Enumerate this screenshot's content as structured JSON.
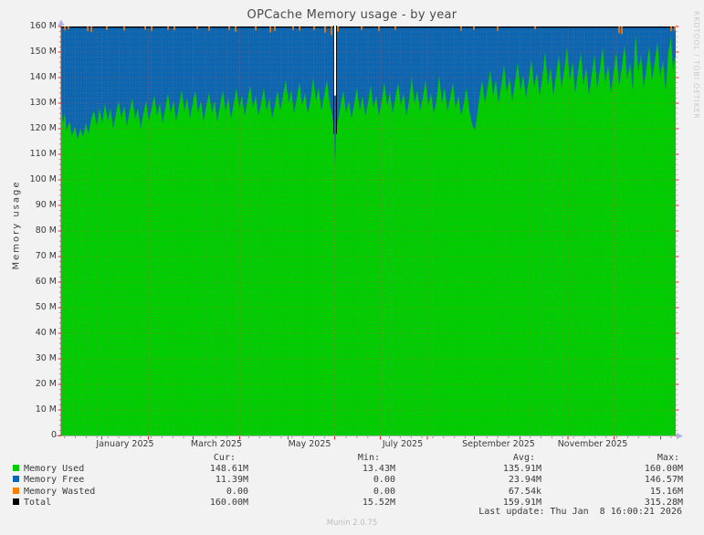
{
  "title": "OPCache Memory usage - by year",
  "watermark": "RRDTOOL / TOBI OETIKER",
  "footer": {
    "munin_version": "Munin 2.0.75",
    "last_update": "Last update: Thu Jan  8 16:00:21 2026"
  },
  "y_axis": {
    "label": "Memory usage",
    "ticks": [
      [
        0,
        "0"
      ],
      [
        10,
        "10 M"
      ],
      [
        20,
        "20 M"
      ],
      [
        30,
        "30 M"
      ],
      [
        40,
        "40 M"
      ],
      [
        50,
        "50 M"
      ],
      [
        60,
        "60 M"
      ],
      [
        70,
        "70 M"
      ],
      [
        80,
        "80 M"
      ],
      [
        90,
        "90 M"
      ],
      [
        100,
        "100 M"
      ],
      [
        110,
        "110 M"
      ],
      [
        120,
        "120 M"
      ],
      [
        130,
        "130 M"
      ],
      [
        140,
        "140 M"
      ],
      [
        150,
        "150 M"
      ],
      [
        160,
        "160 M"
      ]
    ]
  },
  "x_axis": {
    "months": [
      {
        "label": "January 2025",
        "cx": 137
      },
      {
        "label": "March 2025",
        "cx": 237
      },
      {
        "label": "May 2025",
        "cx": 339
      },
      {
        "label": "July 2025",
        "cx": 441
      },
      {
        "label": "September 2025",
        "cx": 546
      },
      {
        "label": "November 2025",
        "cx": 649
      }
    ]
  },
  "legend": {
    "headers": [
      {
        "label": "Cur:",
        "right": 258
      },
      {
        "label": "Min:",
        "right": 416
      },
      {
        "label": "Avg:",
        "right": 586
      },
      {
        "label": "Max:",
        "right": 744
      }
    ],
    "value_col_rights": [
      272,
      433,
      593,
      748
    ],
    "rows": [
      {
        "name": "Memory Used",
        "color": "#00cc00",
        "values": [
          "148.61M",
          "13.43M",
          "135.91M",
          "160.00M"
        ]
      },
      {
        "name": "Memory Free",
        "color": "#0e65b0",
        "values": [
          "11.39M",
          "0.00",
          "23.94M",
          "146.57M"
        ]
      },
      {
        "name": "Memory Wasted",
        "color": "#ff7d00",
        "values": [
          "0.00",
          "0.00",
          "67.54k",
          "15.16M"
        ]
      },
      {
        "name": "Total",
        "color": "#000000",
        "values": [
          "160.00M",
          "15.52M",
          "159.91M",
          "315.28M"
        ]
      }
    ]
  },
  "chart_data": {
    "type": "area",
    "title": "OPCache Memory usage - by year",
    "ylabel": "Memory usage",
    "ylim": [
      0,
      160
    ],
    "x_span": "Dec 2024 - Jan 8 2026",
    "x_unit": "pixel offset across plot (0-673) spanning the year",
    "grid": "dotted, minor 2M / weekly, major 10M / monthly",
    "legend_position": "bottom",
    "series": [
      {
        "name": "Memory Used",
        "render": "area",
        "color": "#00cc00"
      },
      {
        "name": "Memory Free",
        "render": "area stacked up to total 160M",
        "color": "#0e65b0"
      },
      {
        "name": "Memory Wasted",
        "render": "small spikes hanging from the 160M total line",
        "color": "#ff7d00"
      },
      {
        "name": "Total",
        "render": "line at 160M",
        "color": "#000000",
        "value": 160
      }
    ],
    "colors": {
      "used": "#00cc00",
      "free": "#0e65b0",
      "wasted": "#ff7d00",
      "total": "#000000",
      "grid_minor": "#888888",
      "grid_major": "#cc5555",
      "tick_red": "#ee0000",
      "axis": "#999999",
      "arrow": "#aab4e6"
    },
    "total_line": 160,
    "gap": {
      "x": 300,
      "comment": "data gap around Jun 1 2025: white slit 160M->133M, total edge down to 118M, blue notch to ~105M; momentary min total 15.52M / min used 13.43M",
      "min_used": 13.43,
      "min_total": 15.52
    },
    "used_points": [
      [
        0,
        130
      ],
      [
        2,
        122
      ],
      [
        4,
        126
      ],
      [
        6,
        119
      ],
      [
        9,
        123
      ],
      [
        12,
        117
      ],
      [
        15,
        121
      ],
      [
        18,
        116
      ],
      [
        21,
        120
      ],
      [
        24,
        117
      ],
      [
        27,
        122
      ],
      [
        30,
        118
      ],
      [
        33,
        124
      ],
      [
        36,
        127
      ],
      [
        39,
        121
      ],
      [
        42,
        128
      ],
      [
        45,
        122
      ],
      [
        48,
        130
      ],
      [
        51,
        123
      ],
      [
        54,
        128
      ],
      [
        57,
        120
      ],
      [
        60,
        126
      ],
      [
        63,
        131
      ],
      [
        66,
        124
      ],
      [
        69,
        129
      ],
      [
        72,
        121
      ],
      [
        75,
        127
      ],
      [
        78,
        132
      ],
      [
        81,
        124
      ],
      [
        84,
        128
      ],
      [
        87,
        120
      ],
      [
        90,
        126
      ],
      [
        93,
        131
      ],
      [
        96,
        123
      ],
      [
        99,
        128
      ],
      [
        102,
        133
      ],
      [
        105,
        125
      ],
      [
        108,
        130
      ],
      [
        111,
        122
      ],
      [
        114,
        128
      ],
      [
        117,
        134
      ],
      [
        120,
        126
      ],
      [
        123,
        131
      ],
      [
        126,
        123
      ],
      [
        129,
        129
      ],
      [
        132,
        135
      ],
      [
        135,
        127
      ],
      [
        138,
        132
      ],
      [
        141,
        124
      ],
      [
        144,
        130
      ],
      [
        147,
        135
      ],
      [
        150,
        126
      ],
      [
        153,
        131
      ],
      [
        156,
        123
      ],
      [
        159,
        129
      ],
      [
        162,
        134
      ],
      [
        165,
        126
      ],
      [
        168,
        131
      ],
      [
        171,
        123
      ],
      [
        174,
        129
      ],
      [
        177,
        135
      ],
      [
        180,
        127
      ],
      [
        183,
        132
      ],
      [
        186,
        124
      ],
      [
        189,
        130
      ],
      [
        192,
        136
      ],
      [
        195,
        128
      ],
      [
        198,
        133
      ],
      [
        201,
        125
      ],
      [
        204,
        131
      ],
      [
        207,
        137
      ],
      [
        210,
        128
      ],
      [
        213,
        133
      ],
      [
        216,
        125
      ],
      [
        219,
        130
      ],
      [
        222,
        136
      ],
      [
        225,
        127
      ],
      [
        228,
        132
      ],
      [
        231,
        124
      ],
      [
        234,
        129
      ],
      [
        237,
        135
      ],
      [
        240,
        127
      ],
      [
        243,
        133
      ],
      [
        246,
        139
      ],
      [
        249,
        130
      ],
      [
        252,
        135
      ],
      [
        255,
        126
      ],
      [
        258,
        132
      ],
      [
        261,
        138
      ],
      [
        264,
        129
      ],
      [
        267,
        134
      ],
      [
        270,
        126
      ],
      [
        273,
        131
      ],
      [
        276,
        140
      ],
      [
        279,
        131
      ],
      [
        282,
        136
      ],
      [
        285,
        127
      ],
      [
        288,
        133
      ],
      [
        291,
        139
      ],
      [
        294,
        130
      ],
      [
        297,
        125
      ],
      [
        299,
        119
      ],
      [
        300,
        105
      ],
      [
        301,
        119
      ],
      [
        303,
        123
      ],
      [
        306,
        129
      ],
      [
        309,
        135
      ],
      [
        312,
        126
      ],
      [
        315,
        131
      ],
      [
        318,
        124
      ],
      [
        321,
        130
      ],
      [
        324,
        136
      ],
      [
        327,
        127
      ],
      [
        330,
        133
      ],
      [
        333,
        125
      ],
      [
        336,
        130
      ],
      [
        339,
        137
      ],
      [
        342,
        128
      ],
      [
        345,
        133
      ],
      [
        348,
        125
      ],
      [
        351,
        131
      ],
      [
        354,
        138
      ],
      [
        357,
        129
      ],
      [
        360,
        134
      ],
      [
        363,
        126
      ],
      [
        366,
        132
      ],
      [
        369,
        138
      ],
      [
        372,
        129
      ],
      [
        375,
        134
      ],
      [
        378,
        125
      ],
      [
        381,
        131
      ],
      [
        384,
        140
      ],
      [
        387,
        130
      ],
      [
        390,
        135
      ],
      [
        393,
        127
      ],
      [
        396,
        132
      ],
      [
        399,
        139
      ],
      [
        402,
        129
      ],
      [
        405,
        134
      ],
      [
        408,
        126
      ],
      [
        411,
        131
      ],
      [
        414,
        141
      ],
      [
        417,
        130
      ],
      [
        420,
        136
      ],
      [
        423,
        127
      ],
      [
        426,
        132
      ],
      [
        429,
        138
      ],
      [
        432,
        128
      ],
      [
        435,
        133
      ],
      [
        438,
        125
      ],
      [
        441,
        130
      ],
      [
        444,
        136
      ],
      [
        447,
        127
      ],
      [
        450,
        122
      ],
      [
        453,
        119
      ],
      [
        455,
        124
      ],
      [
        458,
        132
      ],
      [
        461,
        139
      ],
      [
        464,
        130
      ],
      [
        467,
        136
      ],
      [
        470,
        143
      ],
      [
        473,
        133
      ],
      [
        476,
        139
      ],
      [
        479,
        130
      ],
      [
        482,
        137
      ],
      [
        485,
        145
      ],
      [
        488,
        134
      ],
      [
        491,
        140
      ],
      [
        494,
        131
      ],
      [
        497,
        138
      ],
      [
        500,
        146
      ],
      [
        503,
        135
      ],
      [
        506,
        141
      ],
      [
        509,
        132
      ],
      [
        512,
        139
      ],
      [
        515,
        147
      ],
      [
        518,
        136
      ],
      [
        521,
        142
      ],
      [
        524,
        133
      ],
      [
        527,
        140
      ],
      [
        530,
        150
      ],
      [
        533,
        137
      ],
      [
        536,
        144
      ],
      [
        539,
        133
      ],
      [
        542,
        141
      ],
      [
        545,
        149
      ],
      [
        548,
        136
      ],
      [
        551,
        143
      ],
      [
        554,
        152
      ],
      [
        557,
        139
      ],
      [
        560,
        146
      ],
      [
        563,
        134
      ],
      [
        566,
        142
      ],
      [
        569,
        150
      ],
      [
        572,
        137
      ],
      [
        575,
        144
      ],
      [
        578,
        133
      ],
      [
        581,
        141
      ],
      [
        584,
        149
      ],
      [
        587,
        136
      ],
      [
        590,
        143
      ],
      [
        593,
        152
      ],
      [
        596,
        138
      ],
      [
        599,
        145
      ],
      [
        602,
        134
      ],
      [
        605,
        142
      ],
      [
        608,
        150
      ],
      [
        611,
        137
      ],
      [
        614,
        144
      ],
      [
        617,
        153
      ],
      [
        620,
        139
      ],
      [
        623,
        146
      ],
      [
        626,
        135
      ],
      [
        629,
        157
      ],
      [
        632,
        142
      ],
      [
        635,
        149
      ],
      [
        638,
        136
      ],
      [
        641,
        144
      ],
      [
        644,
        152
      ],
      [
        647,
        139
      ],
      [
        650,
        146
      ],
      [
        653,
        154
      ],
      [
        656,
        140
      ],
      [
        659,
        147
      ],
      [
        662,
        135
      ],
      [
        665,
        150
      ],
      [
        668,
        156
      ],
      [
        670,
        143
      ],
      [
        672,
        148
      ],
      [
        673,
        148
      ]
    ],
    "wasted_spikes": [
      [
        4,
        1.1
      ],
      [
        8,
        0.7
      ],
      [
        29,
        1.3
      ],
      [
        33,
        1.8
      ],
      [
        50,
        0.9
      ],
      [
        69,
        1.1
      ],
      [
        92,
        0.9
      ],
      [
        99,
        1.3
      ],
      [
        117,
        0.9
      ],
      [
        124,
        1.1
      ],
      [
        149,
        0.7
      ],
      [
        162,
        1.2
      ],
      [
        184,
        0.9
      ],
      [
        191,
        1.6
      ],
      [
        213,
        1.1
      ],
      [
        229,
        1.9
      ],
      [
        234,
        1.3
      ],
      [
        254,
        0.9
      ],
      [
        261,
        1.2
      ],
      [
        277,
        0.9
      ],
      [
        289,
        2.0
      ],
      [
        296,
        2.9
      ],
      [
        303,
        1.6
      ],
      [
        329,
        0.9
      ],
      [
        348,
        1.3
      ],
      [
        366,
        0.9
      ],
      [
        438,
        1.2
      ],
      [
        452,
        0.9
      ],
      [
        478,
        1.3
      ],
      [
        519,
        0.7
      ],
      [
        611,
        2.2
      ],
      [
        614,
        2.6
      ],
      [
        668,
        1.4
      ],
      [
        672,
        1.1
      ]
    ],
    "month_grid_offsets": [
      44.5,
      95.5,
      144.5,
      195.5,
      248.5,
      299.5,
      349.5,
      401,
      452.5,
      502.5,
      555,
      605.5,
      656.5
    ],
    "week_minor_step": 11.86
  }
}
